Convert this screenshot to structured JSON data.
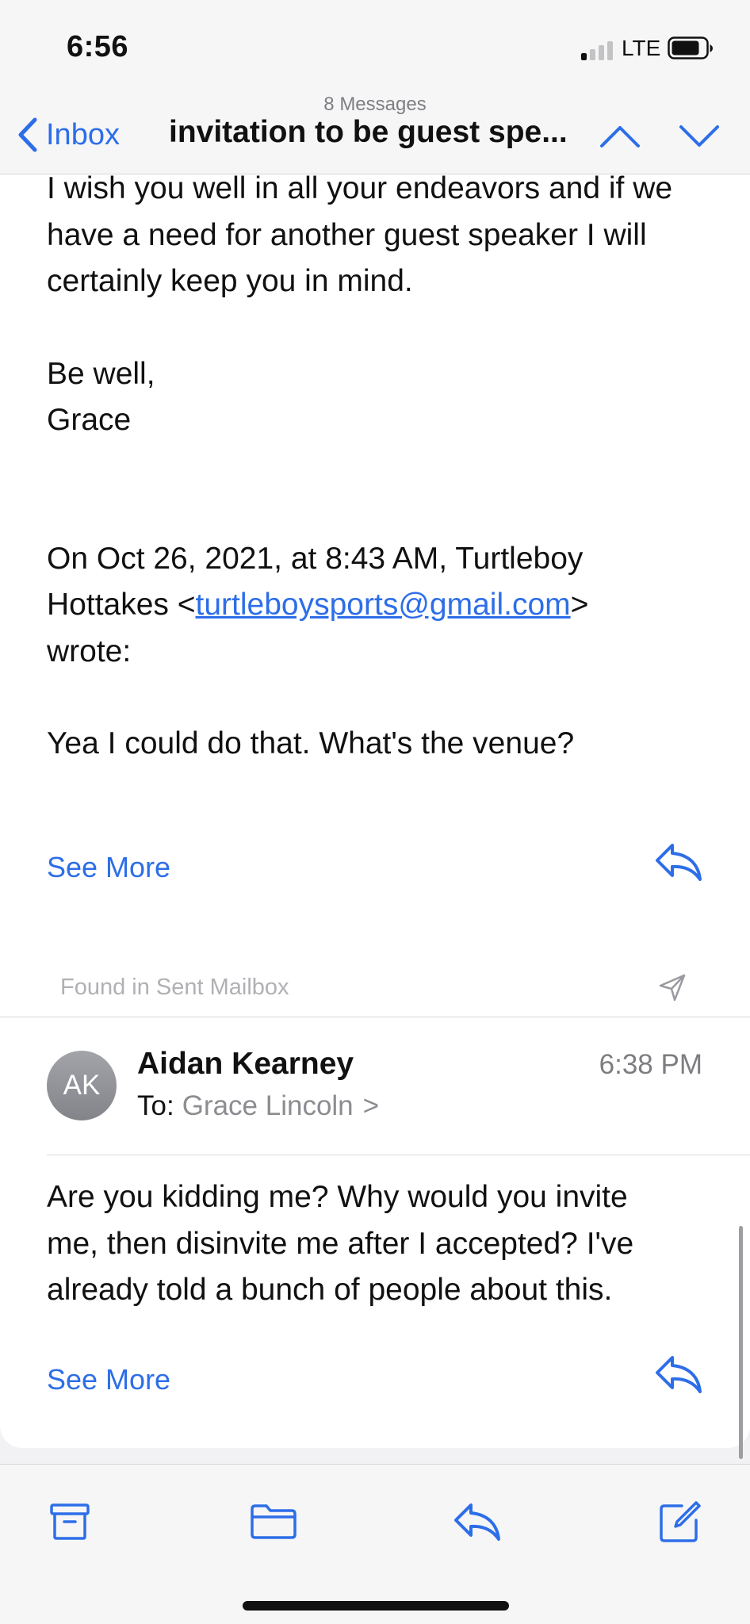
{
  "status": {
    "time": "6:56",
    "network": "LTE"
  },
  "nav": {
    "message_count": "8 Messages",
    "back_label": "Inbox",
    "subject": "invitation to be guest spe..."
  },
  "message1": {
    "lines": [
      "I wish you well in all your endeavors and if we",
      "have a need for another guest speaker I will",
      "certainly keep you  in mind."
    ],
    "signoff": [
      "Be well,",
      "Grace"
    ],
    "quote_intro_1": "On Oct 26, 2021, at 8:43 AM, Turtleboy",
    "quote_intro_2_prefix": "Hottakes <",
    "quote_email": "turtleboysports@gmail.com",
    "quote_intro_2_suffix": ">",
    "quote_intro_3": "wrote:",
    "quoted_body": "Yea I could do that. What's the venue?",
    "see_more": "See More"
  },
  "message2": {
    "found_in": "Found in Sent Mailbox",
    "avatar_initials": "AK",
    "sender": "Aidan Kearney",
    "time": "6:38 PM",
    "to_label": "To:",
    "to_name": "Grace Lincoln",
    "to_chevron": ">",
    "body_lines": [
      "Are you kidding me? Why would you invite",
      "me, then disinvite me after I accepted? I've",
      "already told a bunch of people about this."
    ],
    "see_more": "See More"
  },
  "colors": {
    "accent": "#2d6ee8",
    "background": "#f2f2f4"
  },
  "toolbar": {
    "icons": [
      "archive-icon",
      "folder-icon",
      "reply-icon",
      "compose-icon"
    ]
  }
}
